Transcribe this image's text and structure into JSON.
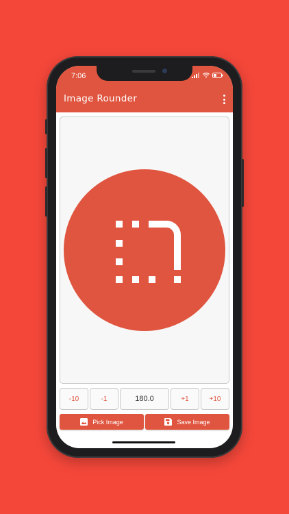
{
  "status_bar": {
    "time": "7:06"
  },
  "app_bar": {
    "title": "Image Rounder",
    "menu_icon": "more-vert-icon"
  },
  "preview": {
    "logo_icon": "rounded-corner-icon",
    "shape_color": "#e0553f"
  },
  "stepper": {
    "minus_10": "-10",
    "minus_1": "-1",
    "value": "180.0",
    "plus_1": "+1",
    "plus_10": "+10"
  },
  "actions": {
    "pick_label": "Pick Image",
    "pick_icon": "image-icon",
    "save_label": "Save Image",
    "save_icon": "save-icon"
  },
  "colors": {
    "background": "#f4473a",
    "accent": "#e0553f"
  }
}
